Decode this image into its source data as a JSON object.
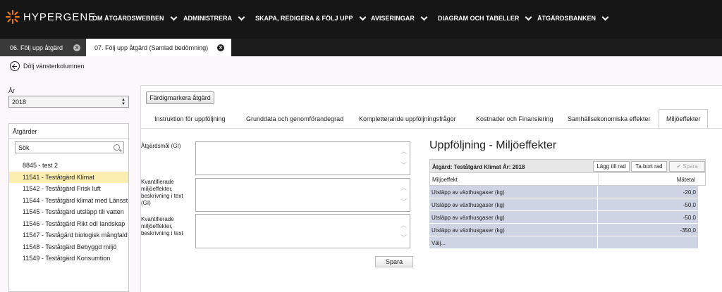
{
  "app": {
    "logo_text": "HYPERGENE"
  },
  "nav": [
    "OM ÅTGÄRDSWEBBEN",
    "ADMINISTRERA",
    "SKAPA, REDIGERA & FÖLJ UPP",
    "AVISERINGAR",
    "DIAGRAM OCH TABELLER",
    "ÅTGÄRDSBANKEN"
  ],
  "doc_tabs": [
    {
      "label": "06. Följ upp åtgärd",
      "active": false
    },
    {
      "label": "07. Följ upp åtgärd (Samlad bedömning)",
      "active": true
    }
  ],
  "hide_column_label": "Dölj vänsterkolumnen",
  "year": {
    "label": "År",
    "value": "2018"
  },
  "actions": {
    "title": "Åtgärder",
    "search_value": "Sök",
    "items": [
      "8845 - test 2",
      "11541 - Teståtgärd Klimat",
      "11542 - Teståtgärd Frisk luft",
      "11544 - Teståtgärd klimat med Länsst",
      "11545 - Teståtgärd utsläpp till vatten",
      "11546 - Teståtgärd Rikt odl landskap",
      "11547 - Testågärd biologisk mångfald",
      "11548 - Teståtgärd Bebyggd miljö",
      "11549 - Teståtgärd Konsumtion"
    ],
    "selected_index": 1
  },
  "main": {
    "finish_button": "Färdigmarkera åtgärd",
    "tabs": [
      "Instruktion för uppföljning",
      "Grunddata och genomförandegrad",
      "Kompletterande uppföljningsfrågor",
      "Kostnader och Finansiering",
      "Samhällsekonomiska effekter",
      "Miljöeffekter"
    ],
    "active_tab": "Miljöeffekter",
    "fields": [
      {
        "label": "Åtgärdsmål (GI)"
      },
      {
        "label": "Kvantifierade miljöeffekter, beskrivning i text (GI)"
      },
      {
        "label": "Kvantifierade miljöeffekter, beskrivning i text"
      }
    ],
    "save_button": "Spara"
  },
  "effects": {
    "title": "Uppföljning - Miljöeffekter",
    "caption": "Åtgärd: Teståtgärd Klimat År: 2018",
    "add_row": "Lägg till rad",
    "remove_row": "Ta bort rad",
    "save": "Spara",
    "col_effect": "Miljoeffekt",
    "col_value": "Mätetal",
    "rows": [
      {
        "effect": "Utsläpp av växthusgaser (kg)",
        "value": "-20,0"
      },
      {
        "effect": "Utsläpp av växthusgaser (kg)",
        "value": "-50,0"
      },
      {
        "effect": "Utsläpp av växthusgaser (kg)",
        "value": "-50,0"
      },
      {
        "effect": "Utsläpp av växthusgaser (kg)",
        "value": "-350,0"
      },
      {
        "effect": "Välj...",
        "value": ""
      }
    ]
  },
  "colors": {
    "nav_bg": "#161616",
    "selected_row": "#fbeeb0",
    "grid_row": "#ced4e4"
  }
}
